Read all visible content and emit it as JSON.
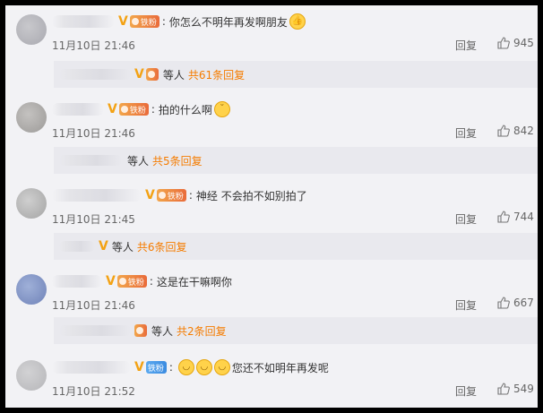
{
  "comments": [
    {
      "content": "你怎么不明年再发啊朋友",
      "emoji": "thumbs-up",
      "fan_badge": "铁粉",
      "time": "11月10日 21:46",
      "reply_label": "回复",
      "likes": "945",
      "sub": {
        "suffix": "等人",
        "count": "共61条回复"
      }
    },
    {
      "content": "拍的什么啊",
      "emoji": "smirk",
      "fan_badge": "铁粉",
      "time": "11月10日 21:46",
      "reply_label": "回复",
      "likes": "842",
      "sub": {
        "suffix": "等人",
        "count": "共5条回复"
      }
    },
    {
      "content": "神经 不会拍不如别拍了",
      "fan_badge": "铁粉",
      "time": "11月10日 21:45",
      "reply_label": "回复",
      "likes": "744",
      "sub": {
        "suffix": "等人",
        "count": "共6条回复"
      }
    },
    {
      "content": "这是在干嘛啊你",
      "fan_badge": "铁粉",
      "time": "11月10日 21:46",
      "reply_label": "回复",
      "likes": "667",
      "sub": {
        "suffix": "等人",
        "count": "共2条回复"
      }
    },
    {
      "content": "您还不如明年再发呢",
      "emoji": "smile",
      "fan_badge": "铁粉",
      "time": "11月10日 21:52",
      "reply_label": "回复",
      "likes": "549"
    }
  ]
}
